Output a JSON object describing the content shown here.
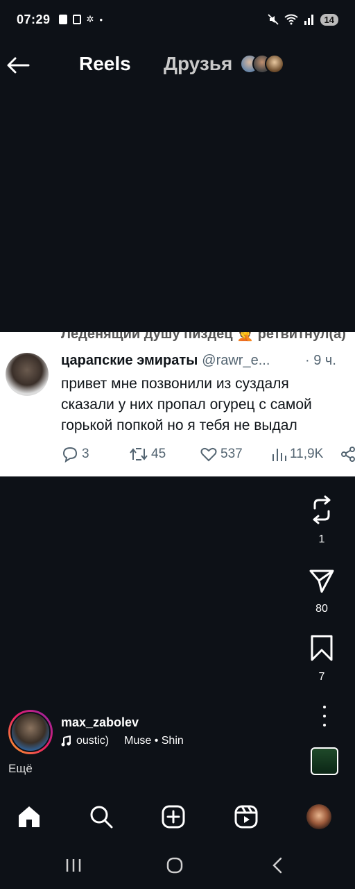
{
  "status_bar": {
    "time": "07:29",
    "battery": "14",
    "left_icons": [
      "alert-icon",
      "check-box-icon",
      "spark-icon",
      "dot-icon"
    ],
    "right_icons": [
      "mute-icon",
      "wifi-icon",
      "signal-icon"
    ]
  },
  "header": {
    "tab_reels": "Reels",
    "tab_friends": "Друзья"
  },
  "tweet": {
    "cut_text": "Леденящий душу пиздец 🤦 ретвитнул(а)",
    "display_name": "царапские эмираты",
    "handle": "@rawr_e...",
    "time": "· 9 ч.",
    "text": "привет мне позвонили из суздаля сказали у них пропал огурец с самой горькой попкой но я тебя не выдал",
    "replies": "3",
    "retweets": "45",
    "likes": "537",
    "views": "11,9K"
  },
  "actions": {
    "reposts": "1",
    "shares": "80",
    "saves": "7"
  },
  "author": {
    "username": "max_zabolev",
    "music_title": "oustic)",
    "music_artist": "Muse • Shin",
    "more": "Ещё"
  },
  "colors": {
    "background": "#0d1117",
    "tweet_bg": "#ffffff",
    "tweet_secondary": "#536471"
  }
}
